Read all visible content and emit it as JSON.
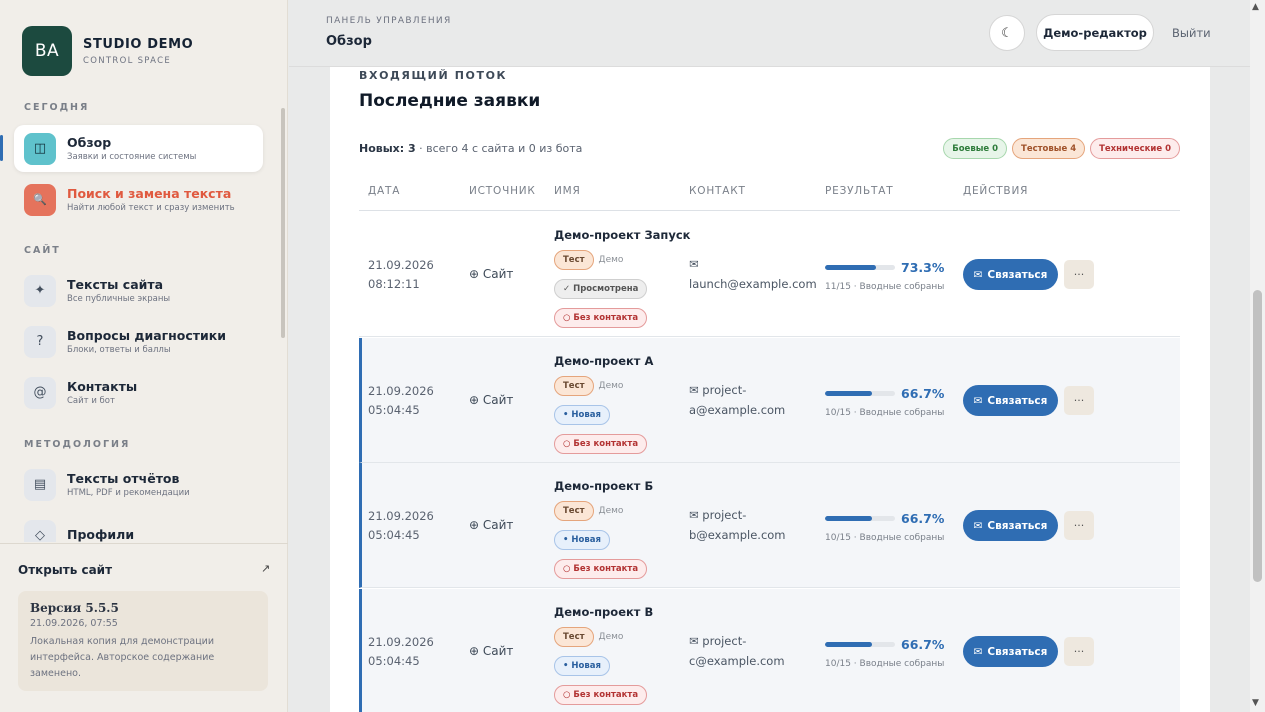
{
  "brand": {
    "initials": "BA",
    "title": "STUDIO DEMO",
    "subtitle": "CONTROL SPACE"
  },
  "sidebar": {
    "sections": [
      {
        "label": "СЕГОДНЯ"
      },
      {
        "label": "САЙТ"
      },
      {
        "label": "МЕТОДОЛОГИЯ"
      }
    ],
    "items": [
      {
        "title": "Обзор",
        "sub": "Заявки и состояние системы",
        "icon": "grid-icon",
        "glyph": "◫"
      },
      {
        "title": "Поиск и замена текста",
        "sub": "Найти любой текст и сразу изменить",
        "icon": "search-icon",
        "glyph": "🔍"
      },
      {
        "title": "Тексты сайта",
        "sub": "Все публичные экраны",
        "icon": "sparkle-icon",
        "glyph": "✦"
      },
      {
        "title": "Вопросы диагностики",
        "sub": "Блоки, ответы и баллы",
        "icon": "question-icon",
        "glyph": "?"
      },
      {
        "title": "Контакты",
        "sub": "Сайт и бот",
        "icon": "at-icon",
        "glyph": "@"
      },
      {
        "title": "Тексты отчётов",
        "sub": "HTML, PDF и рекомендации",
        "icon": "document-icon",
        "glyph": "▤"
      },
      {
        "title": "Профили",
        "sub": "",
        "icon": "diamond-icon",
        "glyph": "◇"
      }
    ],
    "open_site": "Открыть сайт",
    "open_site_icon": "↗",
    "version": {
      "title": "Версия 5.5.5",
      "date": "21.09.2026, 07:55",
      "note": "Локальная копия для демонстрации интерфейса. Авторское содержание заменено."
    }
  },
  "header": {
    "breadcrumb": "ПАНЕЛЬ УПРАВЛЕНИЯ",
    "title": "Обзор",
    "theme_icon": "☾",
    "user": "Демо-редактор",
    "logout": "Выйти"
  },
  "main": {
    "overline": "ВХОДЯЩИЙ ПОТОК",
    "title": "Последние заявки",
    "summary_new": "Новых: 3",
    "summary_rest": " · всего 4 с сайта и 0 из бота",
    "badges": {
      "live": "Боевые 0",
      "test": "Тестовые 4",
      "tech": "Технические 0"
    },
    "columns": [
      "ДАТА",
      "ИСТОЧНИК",
      "ИМЯ",
      "КОНТАКТ",
      "РЕЗУЛЬТАТ",
      "ДЕЙСТВИЯ"
    ],
    "rows": [
      {
        "date": "21.09.2026",
        "time": "08:12:11",
        "source": "Сайт",
        "name": "Демо-проект Запуск",
        "tag": "Тест",
        "tag2": "Демо",
        "status": "✓ Просмотрена",
        "status_kind": "seen",
        "contact_flag": "○ Без контакта",
        "email": "launch@example.com",
        "percent": "73.3%",
        "progress": 0.733,
        "result": "11/15 · Вводные собраны",
        "action": "Связаться"
      },
      {
        "date": "21.09.2026",
        "time": "05:04:45",
        "source": "Сайт",
        "name": "Демо-проект А",
        "tag": "Тест",
        "tag2": "Демо",
        "status": "• Новая",
        "status_kind": "new",
        "contact_flag": "○ Без контакта",
        "email": "project-a@example.com",
        "percent": "66.7%",
        "progress": 0.667,
        "result": "10/15 · Вводные собраны",
        "action": "Связаться"
      },
      {
        "date": "21.09.2026",
        "time": "05:04:45",
        "source": "Сайт",
        "name": "Демо-проект Б",
        "tag": "Тест",
        "tag2": "Демо",
        "status": "• Новая",
        "status_kind": "new",
        "contact_flag": "○ Без контакта",
        "email": "project-b@example.com",
        "percent": "66.7%",
        "progress": 0.667,
        "result": "10/15 · Вводные собраны",
        "action": "Связаться"
      },
      {
        "date": "21.09.2026",
        "time": "05:04:45",
        "source": "Сайт",
        "name": "Демо-проект В",
        "tag": "Тест",
        "tag2": "Демо",
        "status": "• Новая",
        "status_kind": "new",
        "contact_flag": "○ Без контакта",
        "email": "project-c@example.com",
        "percent": "66.7%",
        "progress": 0.667,
        "result": "10/15 · Вводные собраны",
        "action": "Связаться"
      }
    ]
  }
}
